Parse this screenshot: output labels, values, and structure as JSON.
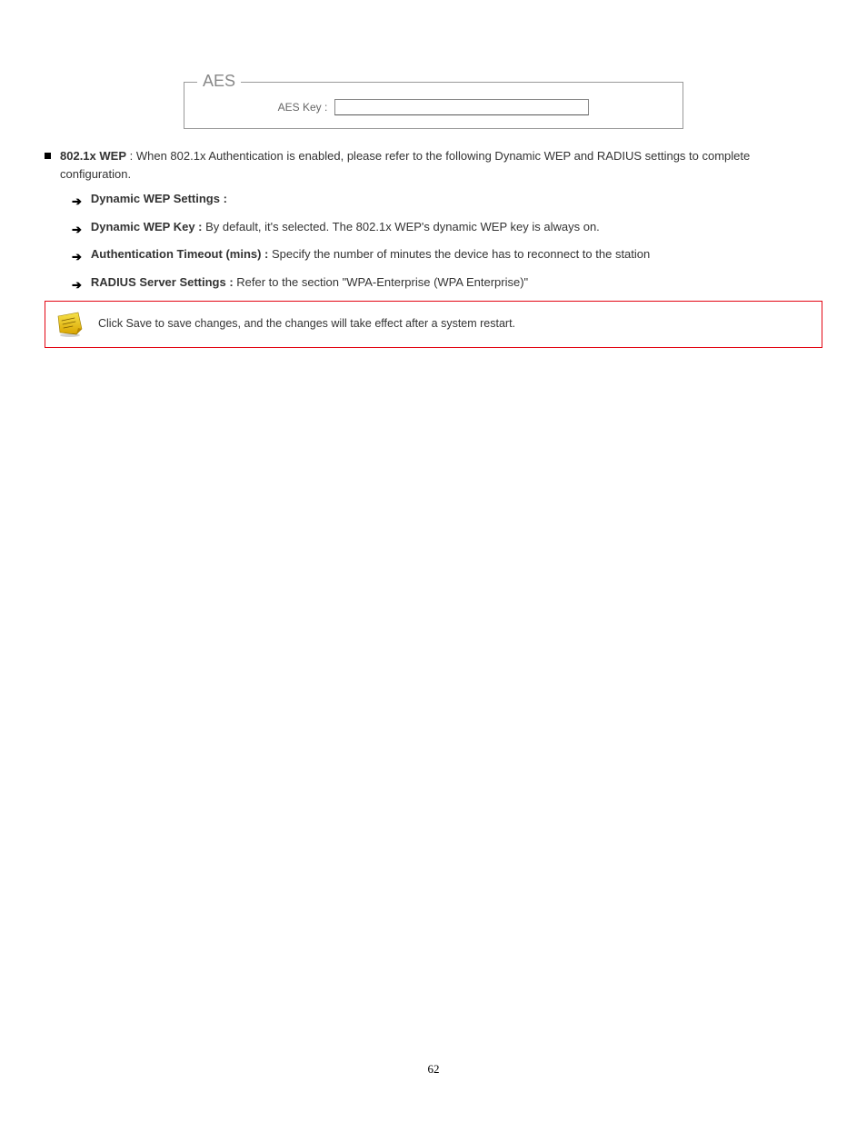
{
  "figure": {
    "legend": "AES",
    "field_label": "AES Key :",
    "field_value": ""
  },
  "section": {
    "title_label": "802.1x WEP",
    "title_rest": " : When 802.1x Authentication is enabled, please refer to the following Dynamic WEP and RADIUS settings to complete configuration.",
    "items": [
      {
        "label": "Dynamic WEP Settings :",
        "rest": ""
      },
      {
        "label": "Dynamic WEP Key :",
        "rest": " By default, it's selected. The 802.1x WEP's dynamic WEP key is always on."
      },
      {
        "label": "Authentication Timeout (mins) :",
        "rest": " Specify the number of minutes the device has to reconnect to the station"
      },
      {
        "label": "RADIUS Server Settings :",
        "rest": " Refer to the section \"WPA-Enterprise (WPA Enterprise)\""
      }
    ]
  },
  "note": {
    "text": "Click Save to save changes, and the changes will take effect after a system restart."
  },
  "page_number": "62"
}
